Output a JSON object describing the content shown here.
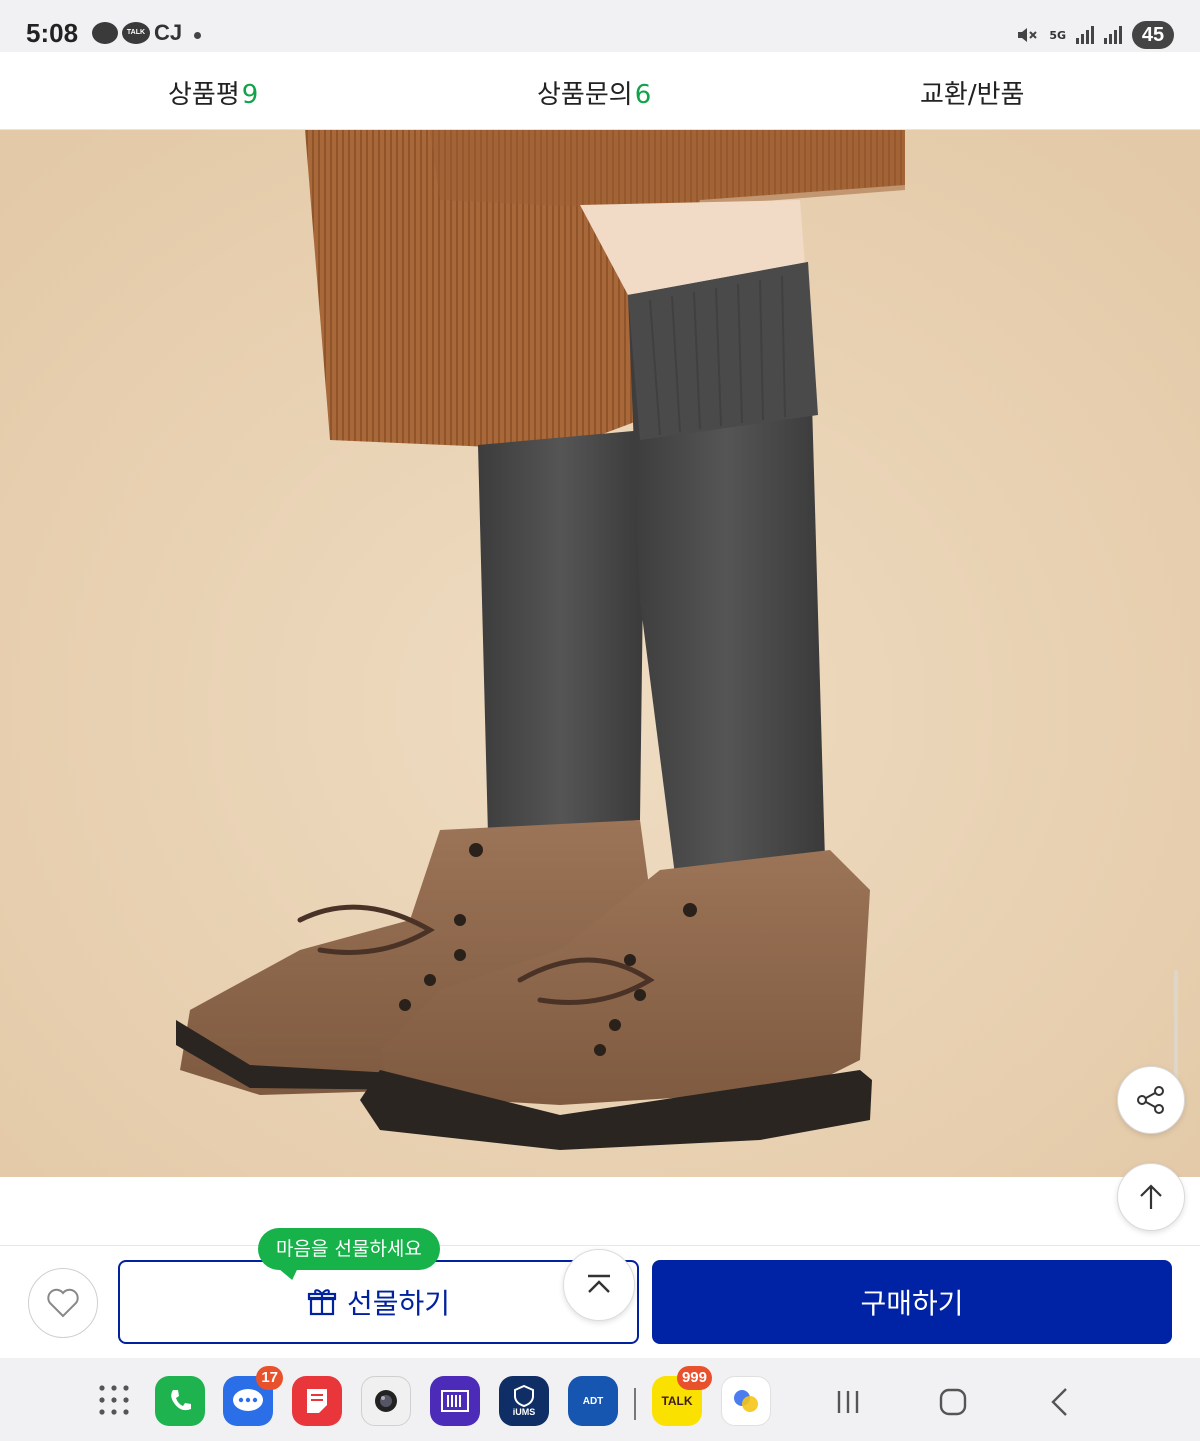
{
  "status_bar": {
    "time": "5:08",
    "talk_label": "TALK",
    "cj_label": "CJ",
    "network": "5G",
    "battery": "45"
  },
  "tabs": [
    {
      "label": "상품평",
      "count": "9"
    },
    {
      "label": "상품문의",
      "count": "6"
    },
    {
      "label": "교환/반품",
      "count": ""
    }
  ],
  "product_image": {
    "description_icon": "product-photo"
  },
  "purchase_bar": {
    "tooltip": "마음을 선물하세요",
    "gift_label": "선물하기",
    "buy_label": "구매하기",
    "accent_color": "#0022a5",
    "tooltip_color": "#17b24a"
  },
  "dock": {
    "messages_badge": "17",
    "kakaotalk_badge": "999",
    "kakaotalk_label": "TALK",
    "iums_label": "iUMS",
    "adt_label": "ADT"
  }
}
